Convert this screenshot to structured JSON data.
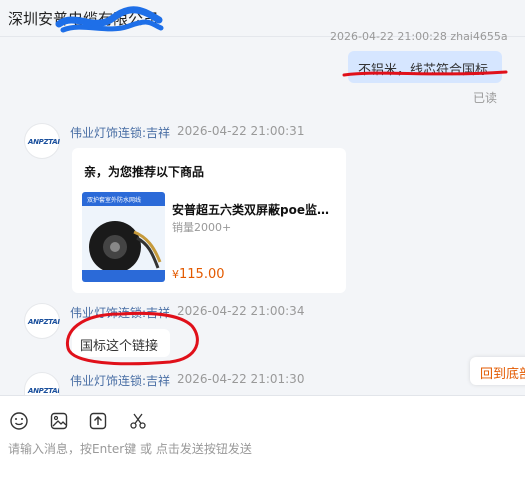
{
  "header": {
    "title": "深圳安普电缆有限公司"
  },
  "messages": {
    "outgoing": {
      "meta": "2026-04-22 21:00:28 zhai4655a",
      "text": "不铝米，线芯符合国标",
      "status": "已读"
    },
    "incoming": [
      {
        "sender": "伟业灯饰连锁:吉祥",
        "time": "2026-04-22 21:00:31",
        "avatar_text": "ANPZTAI",
        "card": {
          "header": "亲，为您推荐以下商品",
          "product_title": "安普超五六类双屏蔽poe监控网线",
          "sales": "销量2000+",
          "price_symbol": "¥",
          "price": "115.00",
          "image_caption": "双护套室外防水网线"
        }
      },
      {
        "sender": "伟业灯饰连锁:吉祥",
        "time": "2026-04-22 21:00:34",
        "avatar_text": "ANPZTAI",
        "text": "国标这个链接"
      },
      {
        "sender": "伟业灯饰连锁:吉祥",
        "time": "2026-04-22 21:01:30",
        "avatar_text": "ANPZTAI"
      }
    ]
  },
  "back_to_bottom": "回到底部",
  "toolbar": {
    "icons": [
      "emoji-icon",
      "image-icon",
      "upload-icon",
      "scissors-icon"
    ]
  },
  "input": {
    "placeholder": "请输入消息，按Enter键 或 点击发送按钮发送"
  },
  "colors": {
    "accent": "#e35a00",
    "annotation": "#e0101a",
    "redaction": "#1e6fe8",
    "outgoing_bubble": "#d6e6ff"
  }
}
